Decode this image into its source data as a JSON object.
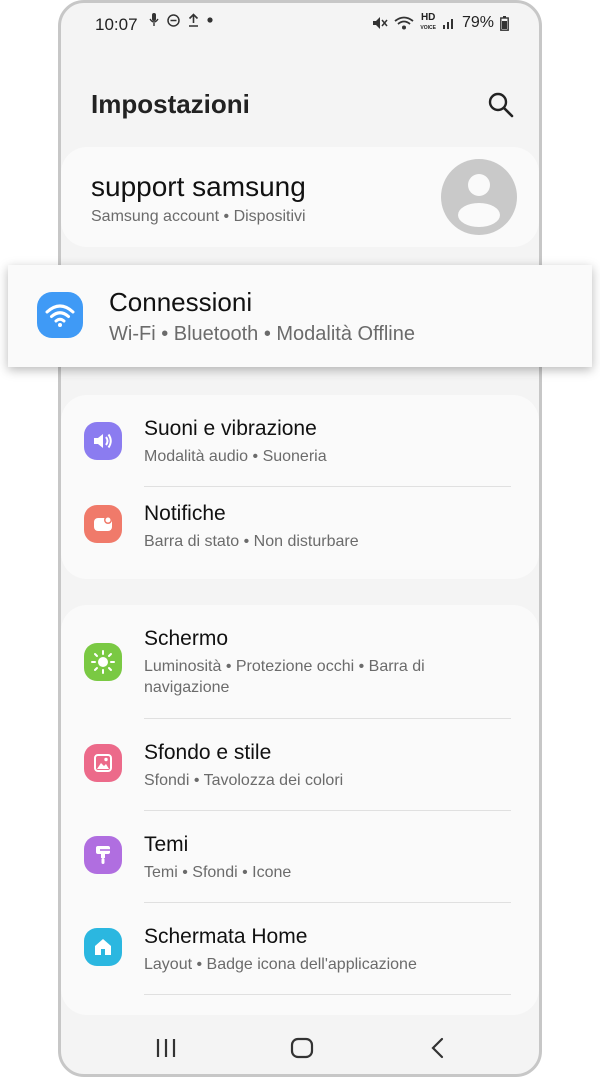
{
  "status_bar": {
    "time": "10:07",
    "hd_label_top": "HD",
    "hd_label_bottom": "VOICE",
    "battery": "79%",
    "left_icons": [
      "mic-icon",
      "do-not-disturb-icon",
      "upload-icon",
      "dot-icon"
    ],
    "right_icons": [
      "mute-icon",
      "wifi-icon",
      "hd-voice-icon",
      "signal-icon",
      "battery-icon"
    ]
  },
  "header": {
    "title": "Impostazioni",
    "search_icon": "search-icon"
  },
  "account": {
    "name": "support samsung",
    "subtitle": "Samsung account  •  Dispositivi",
    "avatar_icon": "person-icon"
  },
  "highlighted_item": {
    "title": "Connessioni",
    "subtitle": "Wi-Fi  •  Bluetooth  •  Modalità Offline",
    "icon": "wifi-icon",
    "icon_color": "#3f9af6"
  },
  "groups": [
    {
      "items": [
        {
          "title": "Suoni e vibrazione",
          "subtitle": "Modalità audio  •  Suoneria",
          "icon": "speaker-icon",
          "icon_color": "#8b7cf0"
        },
        {
          "title": "Notifiche",
          "subtitle": "Barra di stato  •  Non disturbare",
          "icon": "notification-icon",
          "icon_color": "#f07a6a"
        }
      ]
    },
    {
      "items": [
        {
          "title": "Schermo",
          "subtitle": "Luminosità  •  Protezione occhi  •  Barra di navigazione",
          "icon": "brightness-icon",
          "icon_color": "#7ac943"
        },
        {
          "title": "Sfondo e stile",
          "subtitle": "Sfondi  •  Tavolozza dei colori",
          "icon": "wallpaper-icon",
          "icon_color": "#ec6a8a"
        },
        {
          "title": "Temi",
          "subtitle": "Temi  •  Sfondi  •  Icone",
          "icon": "brush-icon",
          "icon_color": "#b06ee0"
        },
        {
          "title": "Schermata Home",
          "subtitle": "Layout  •  Badge icona dell'applicazione",
          "icon": "home-icon",
          "icon_color": "#2bb7e0"
        }
      ]
    }
  ],
  "navigation_bar": {
    "buttons": [
      "recents-icon",
      "home-button-icon",
      "back-icon"
    ]
  }
}
